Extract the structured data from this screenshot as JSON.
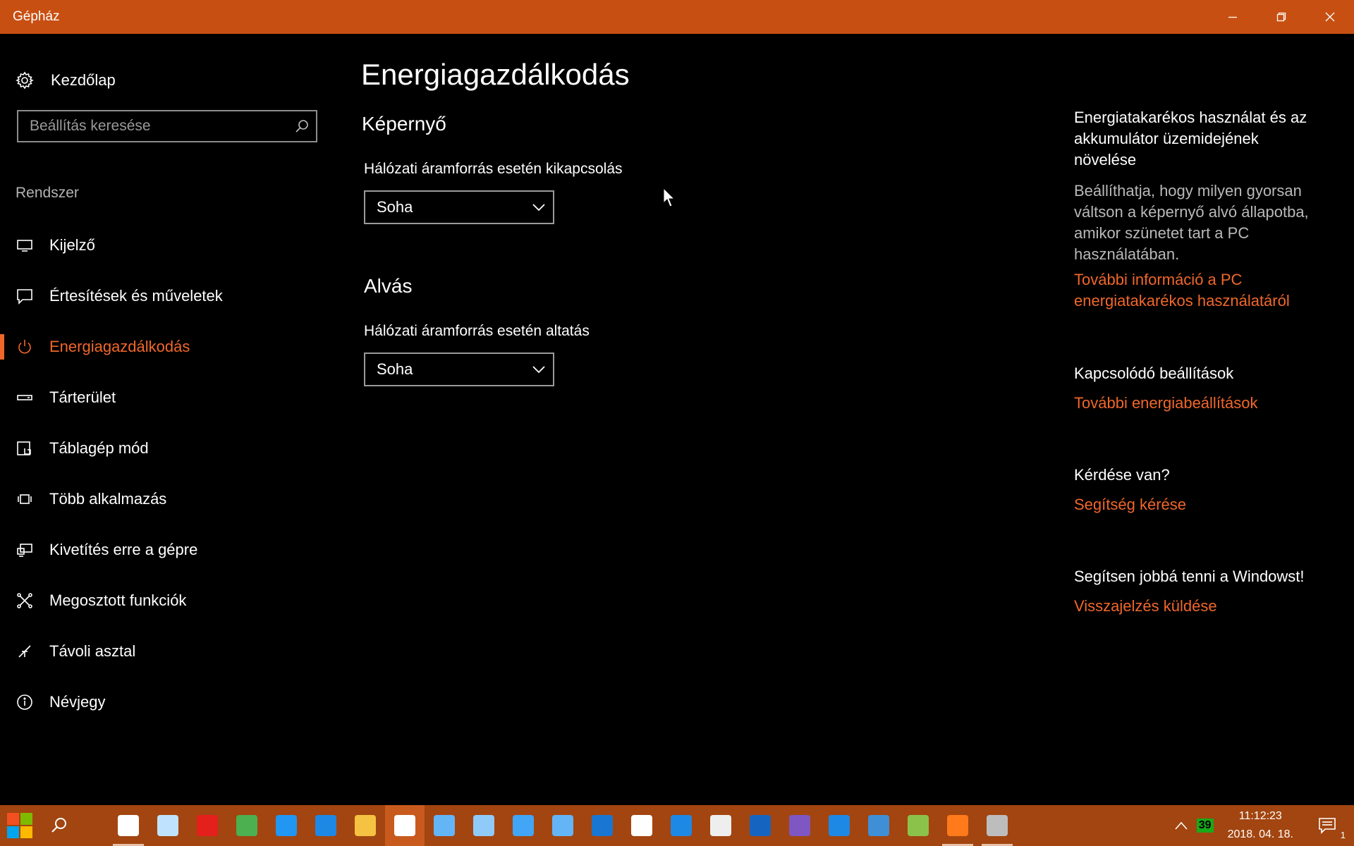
{
  "window": {
    "title": "Gépház"
  },
  "sidebar": {
    "home_label": "Kezdőlap",
    "search_placeholder": "Beállítás keresése",
    "section_label": "Rendszer",
    "items": [
      {
        "label": "Kijelző",
        "icon": "monitor-icon"
      },
      {
        "label": "Értesítések és műveletek",
        "icon": "notification-icon"
      },
      {
        "label": "Energiagazdálkodás",
        "icon": "power-icon",
        "active": true
      },
      {
        "label": "Tárterület",
        "icon": "storage-icon"
      },
      {
        "label": "Táblagép mód",
        "icon": "tablet-mode-icon"
      },
      {
        "label": "Több alkalmazás",
        "icon": "multitasking-icon"
      },
      {
        "label": "Kivetítés erre a gépre",
        "icon": "projecting-icon"
      },
      {
        "label": "Megosztott funkciók",
        "icon": "shared-experiences-icon"
      },
      {
        "label": "Távoli asztal",
        "icon": "remote-desktop-icon"
      },
      {
        "label": "Névjegy",
        "icon": "info-icon"
      }
    ]
  },
  "main": {
    "title": "Energiagazdálkodás",
    "screen_section": {
      "heading": "Képernyő",
      "field_label": "Hálózati áramforrás esetén kikapcsolás",
      "value": "Soha"
    },
    "sleep_section": {
      "heading": "Alvás",
      "field_label": "Hálózati áramforrás esetén altatás",
      "value": "Soha"
    }
  },
  "right": {
    "tip_heading": "Energiatakarékos használat és az akkumulátor üzemidejének növelése",
    "tip_text": "Beállíthatja, hogy milyen gyorsan váltson a képernyő alvó állapotba, amikor szünetet tart a PC használatában.",
    "tip_link": "További információ a PC energiatakarékos használatáról",
    "related_heading": "Kapcsolódó beállítások",
    "related_link": "További energiabeállítások",
    "question_heading": "Kérdése van?",
    "question_link": "Segítség kérése",
    "feedback_heading": "Segítsen jobbá tenni a Windowst!",
    "feedback_link": "Visszajelzés küldése"
  },
  "taskbar": {
    "apps": [
      {
        "name": "sticky-notes-icon",
        "color": "#ffffff",
        "running": true
      },
      {
        "name": "ghost-app-icon",
        "color": "#bfe3ff"
      },
      {
        "name": "acrobat-icon",
        "color": "#e3201b"
      },
      {
        "name": "green-globe-icon",
        "color": "#4caf50"
      },
      {
        "name": "resource-monitor-icon",
        "color": "#2196f3"
      },
      {
        "name": "edge-icon",
        "color": "#1e88e5"
      },
      {
        "name": "file-explorer-icon",
        "color": "#f5c242"
      },
      {
        "name": "settings-gear-icon",
        "color": "#ffffff",
        "active": true
      },
      {
        "name": "control-panel-icon",
        "color": "#64b5f6"
      },
      {
        "name": "network-icon",
        "color": "#90caf9"
      },
      {
        "name": "scanner-icon",
        "color": "#42a5f5"
      },
      {
        "name": "computer-icon",
        "color": "#64b5f6"
      },
      {
        "name": "remote-computer-icon",
        "color": "#1976d2"
      },
      {
        "name": "fox-mask-icon",
        "color": "#ffffff"
      },
      {
        "name": "sync-icon",
        "color": "#1e88e5"
      },
      {
        "name": "film-icon",
        "color": "#eeeeee"
      },
      {
        "name": "server-rack-icon",
        "color": "#1565c0"
      },
      {
        "name": "viber-icon",
        "color": "#7e57c2"
      },
      {
        "name": "floppy-icon",
        "color": "#1e88e5"
      },
      {
        "name": "thunderbird-icon",
        "color": "#3f8fd6"
      },
      {
        "name": "world-map-icon",
        "color": "#8bc34a"
      },
      {
        "name": "firefox-icon",
        "color": "#ff7a1a",
        "running": true
      },
      {
        "name": "disk-utility-icon",
        "color": "#bdbdbd",
        "running": true
      }
    ],
    "tray": {
      "badge_value": "39",
      "time": "11:12:23",
      "date": "2018. 04. 18.",
      "notification_count": "1"
    }
  }
}
